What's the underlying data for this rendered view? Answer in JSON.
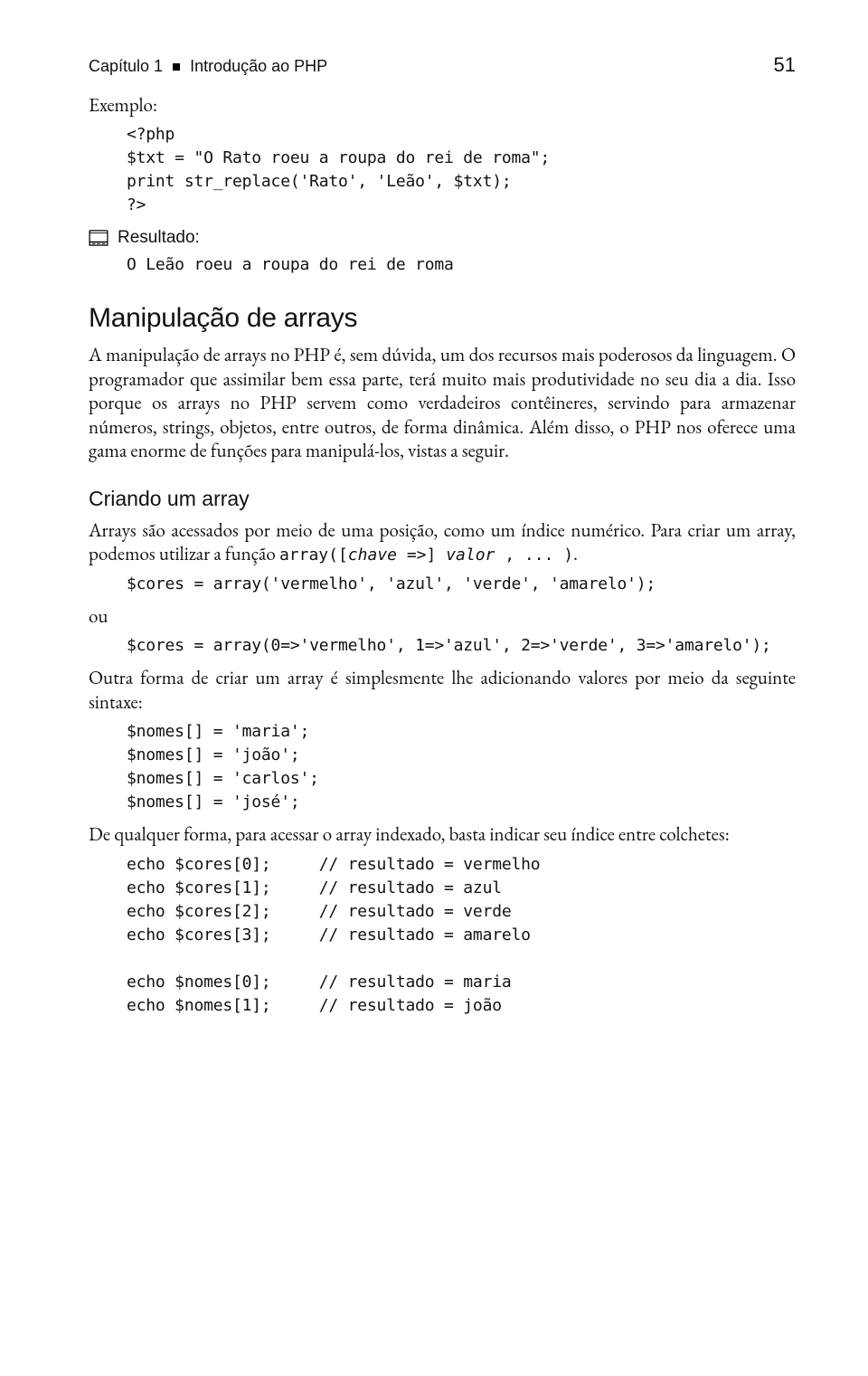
{
  "header": {
    "chapter_label": "Capítulo 1",
    "chapter_title": "Introdução ao PHP",
    "page_number": "51"
  },
  "exemplo_label": "Exemplo:",
  "exemplo_code": [
    "<?php",
    "$txt = \"O Rato roeu a roupa do rei de roma\";",
    "print str_replace('Rato', 'Leão', $txt);",
    "?>"
  ],
  "resultado_label": "Resultado:",
  "resultado_code": "O Leão roeu a roupa do rei de roma",
  "section_manipulacao": {
    "title": "Manipulação de arrays",
    "paragraph": "A manipulação de arrays no PHP é, sem dúvida, um dos recursos mais poderosos da linguagem. O programador que assimilar bem essa parte, terá muito mais produtividade no seu dia a dia. Isso porque os arrays no PHP servem como verdadeiros contêineres, servindo para armazenar números, strings, objetos, entre outros, de forma dinâmica. Além disso, o PHP nos oferece uma gama enorme de funções para manipulá-los, vistas a seguir."
  },
  "section_criando": {
    "title": "Criando um array",
    "para1_pre": "Arrays são acessados por meio de uma posição, como um índice numérico. Para criar um array, podemos utilizar a função ",
    "para1_mono_a": "array([",
    "para1_mono_ital": "chave =>",
    "para1_mono_b": "] ",
    "para1_mono_ital2": "valor",
    "para1_mono_c": " , ... )",
    "para1_post": ".",
    "code1": "$cores = array('vermelho', 'azul', 'verde', 'amarelo');",
    "ou": "ou",
    "code2": "$cores = array(0=>'vermelho', 1=>'azul', 2=>'verde', 3=>'amarelo');",
    "para2": "Outra forma de criar um array é simplesmente lhe adicionando valores por meio da seguinte sintaxe:",
    "code3": [
      "$nomes[] = 'maria';",
      "$nomes[] = 'joão';",
      "$nomes[] = 'carlos';",
      "$nomes[] = 'josé';"
    ],
    "para3": "De qualquer forma, para acessar o array indexado, basta indicar seu índice entre colchetes:",
    "code4": [
      "echo $cores[0];     // resultado = vermelho",
      "echo $cores[1];     // resultado = azul",
      "echo $cores[2];     // resultado = verde",
      "echo $cores[3];     // resultado = amarelo",
      "",
      "echo $nomes[0];     // resultado = maria",
      "echo $nomes[1];     // resultado = joão"
    ]
  }
}
